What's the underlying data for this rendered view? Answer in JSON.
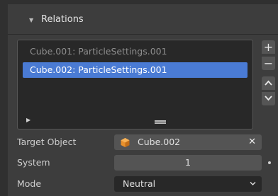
{
  "panel": {
    "title": "Relations"
  },
  "list": {
    "items": [
      {
        "label": "Cube.001: ParticleSettings.001",
        "selected": false
      },
      {
        "label": "Cube.002: ParticleSettings.001",
        "selected": true
      }
    ],
    "buttons": {
      "add": "+",
      "remove": "−"
    }
  },
  "props": {
    "target_label": "Target Object",
    "target_value": "Cube.002",
    "system_label": "System",
    "system_value": "1",
    "mode_label": "Mode",
    "mode_value": "Neutral"
  },
  "colors": {
    "selection": "#4a7bd4",
    "object_icon": "#e8912d"
  },
  "icons": {
    "collapse": "disclosure-triangle-down-icon",
    "object": "cube-object-icon",
    "clear": "x-icon",
    "dropdown": "chevron-down-icon"
  }
}
